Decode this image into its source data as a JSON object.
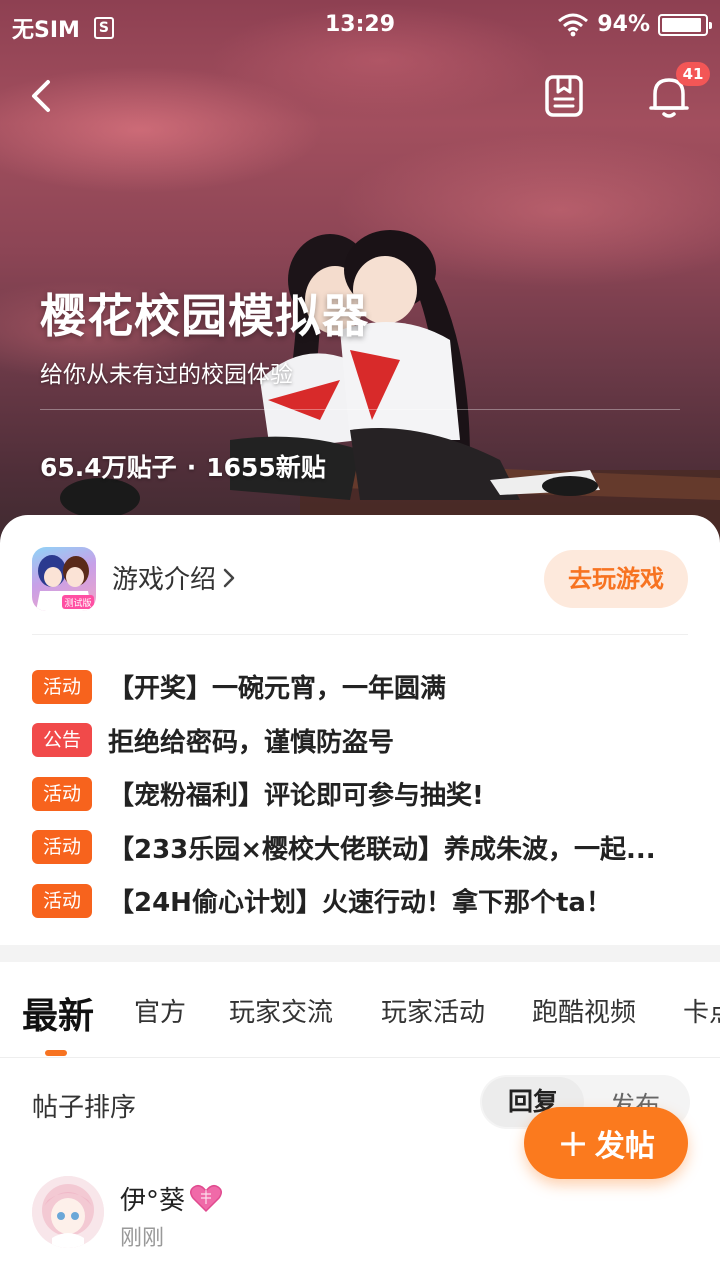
{
  "status_bar": {
    "carrier": "无SIM",
    "sim_icon_glyph": "S",
    "time": "13:29",
    "battery_percent": "94%",
    "battery_level": 0.94
  },
  "header": {
    "notification_badge": "41"
  },
  "hero": {
    "title": "樱花校园模拟器",
    "subtitle": "给你从未有过的校园体验",
    "posts_count": "65.4万贴子",
    "separator": "·",
    "new_posts": "1655新贴"
  },
  "game": {
    "intro_label": "游戏介绍",
    "icon_badge": "测试版",
    "play_button": "去玩游戏"
  },
  "notices": [
    {
      "tag": "活动",
      "type": "activity",
      "text": "【开奖】一碗元宵，一年圆满"
    },
    {
      "tag": "公告",
      "type": "announce",
      "text": "拒绝给密码，谨慎防盗号"
    },
    {
      "tag": "活动",
      "type": "activity",
      "text": "【宠粉福利】评论即可参与抽奖!"
    },
    {
      "tag": "活动",
      "type": "activity",
      "text": "【233乐园×樱校大佬联动】养成朱波，一起..."
    },
    {
      "tag": "活动",
      "type": "activity",
      "text": "【24H偷心计划】火速行动！拿下那个ta！"
    }
  ],
  "tabs": [
    "最新",
    "官方",
    "玩家交流",
    "玩家活动",
    "跑酷视频",
    "卡点"
  ],
  "sort": {
    "label": "帖子排序",
    "active": "回复",
    "inactive": "发布"
  },
  "fab": {
    "plus": "+",
    "label": "发帖"
  },
  "post": {
    "username": "伊°葵",
    "time": "刚刚"
  },
  "colors": {
    "accent": "#f77321",
    "activity_tag": "#f7631d",
    "announce_tag": "#f14a4a",
    "badge": "#f35656"
  }
}
